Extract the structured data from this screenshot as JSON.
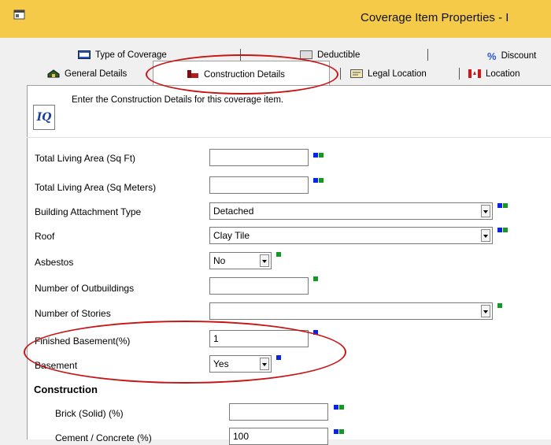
{
  "window": {
    "title": "Coverage Item Properties - I"
  },
  "tabs": {
    "row1": [
      {
        "label": "Type of Coverage",
        "icon": "fax-icon"
      },
      {
        "label": "Deductible",
        "icon": "deductible-icon"
      },
      {
        "label": "Discount",
        "icon": "percent-icon"
      }
    ],
    "row2": [
      {
        "label": "General Details",
        "icon": "house-icon"
      },
      {
        "label": "Construction Details",
        "icon": "building-icon"
      },
      {
        "label": "Legal Location",
        "icon": "card-icon"
      },
      {
        "label": "Location",
        "icon": "canada-flag-icon"
      }
    ]
  },
  "content": {
    "iq_logo": "IQ",
    "instruction": "Enter the Construction Details for this coverage item."
  },
  "fields": [
    {
      "label": "Total Living Area (Sq Ft)",
      "value": "",
      "type": "text"
    },
    {
      "label": "Total Living Area (Sq Meters)",
      "value": "",
      "type": "text"
    },
    {
      "label": "Building Attachment Type",
      "value": "Detached",
      "type": "select"
    },
    {
      "label": "Roof",
      "value": "Clay Tile",
      "type": "select"
    },
    {
      "label": "Asbestos",
      "value": "No",
      "type": "select"
    },
    {
      "label": "Number of Outbuildings",
      "value": "",
      "type": "text"
    },
    {
      "label": "Number of Stories",
      "value": "",
      "type": "select"
    },
    {
      "label": "Finished Basement(%)",
      "value": "1",
      "type": "text"
    },
    {
      "label": "Basement",
      "value": "Yes",
      "type": "select"
    }
  ],
  "construction": {
    "heading": "Construction",
    "fields": [
      {
        "label": "Brick (Solid) (%)",
        "value": ""
      },
      {
        "label": "Cement / Concrete (%)",
        "value": "100"
      }
    ]
  },
  "colors": {
    "titlebar": "#f4ca48",
    "blue_indicator": "#0a24e6",
    "green_indicator": "#109c22",
    "highlight_ring": "#c81414"
  }
}
